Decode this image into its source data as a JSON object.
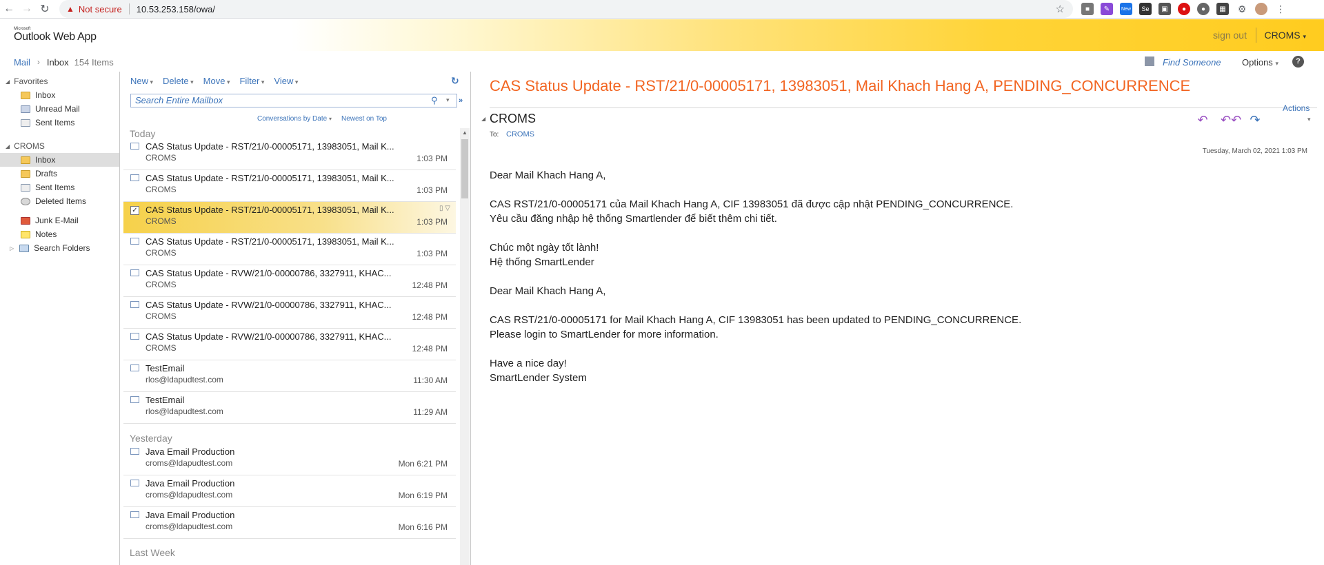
{
  "browser": {
    "security_label": "Not secure",
    "url": "10.53.253.158/owa/",
    "ext_new_badge": "New",
    "ext_se": "Se"
  },
  "header": {
    "logo_small": "Microsoft",
    "logo": "Outlook Web App",
    "signout": "sign out",
    "user": "CROMS"
  },
  "crumb": {
    "root": "Mail",
    "folder": "Inbox",
    "count": "154 Items",
    "find_someone": "Find Someone",
    "options": "Options"
  },
  "leftnav": {
    "favorites_label": "Favorites",
    "favorites": [
      "Inbox",
      "Unread Mail",
      "Sent Items"
    ],
    "mailbox_label": "CROMS",
    "folders": [
      "Inbox",
      "Drafts",
      "Sent Items",
      "Deleted Items",
      "Junk E-Mail",
      "Notes",
      "Search Folders"
    ]
  },
  "list": {
    "toolbar": [
      "New",
      "Delete",
      "Move",
      "Filter",
      "View"
    ],
    "search_placeholder": "Search Entire Mailbox",
    "sort_by": "Conversations by Date",
    "sort_order": "Newest on Top",
    "groups": [
      "Today",
      "Yesterday",
      "Last Week"
    ],
    "messages": [
      {
        "subject": "CAS Status Update - RST/21/0-00005171, 13983051, Mail K...",
        "from": "CROMS",
        "time": "1:03 PM"
      },
      {
        "subject": "CAS Status Update - RST/21/0-00005171, 13983051, Mail K...",
        "from": "CROMS",
        "time": "1:03 PM"
      },
      {
        "subject": "CAS Status Update - RST/21/0-00005171, 13983051, Mail K...",
        "from": "CROMS",
        "time": "1:03 PM"
      },
      {
        "subject": "CAS Status Update - RST/21/0-00005171, 13983051, Mail K...",
        "from": "CROMS",
        "time": "1:03 PM"
      },
      {
        "subject": "CAS Status Update - RVW/21/0-00000786, 3327911, KHAC...",
        "from": "CROMS",
        "time": "12:48 PM"
      },
      {
        "subject": "CAS Status Update - RVW/21/0-00000786, 3327911, KHAC...",
        "from": "CROMS",
        "time": "12:48 PM"
      },
      {
        "subject": "CAS Status Update - RVW/21/0-00000786, 3327911, KHAC...",
        "from": "CROMS",
        "time": "12:48 PM"
      },
      {
        "subject": "TestEmail",
        "from": "rlos@ldapudtest.com",
        "time": "11:30 AM"
      },
      {
        "subject": "TestEmail",
        "from": "rlos@ldapudtest.com",
        "time": "11:29 AM"
      },
      {
        "subject": "Java Email Production",
        "from": "croms@ldapudtest.com",
        "time": "Mon 6:21 PM"
      },
      {
        "subject": "Java Email Production",
        "from": "croms@ldapudtest.com",
        "time": "Mon 6:19 PM"
      },
      {
        "subject": "Java Email Production",
        "from": "croms@ldapudtest.com",
        "time": "Mon 6:16 PM"
      }
    ]
  },
  "reading": {
    "subject": "CAS Status Update - RST/21/0-00005171, 13983051, Mail Khach Hang A, PENDING_CONCURRENCE",
    "actions": "Actions",
    "sender": "CROMS",
    "to_label": "To:",
    "to_value": "CROMS",
    "date": "Tuesday, March 02, 2021 1:03 PM",
    "body": [
      "Dear Mail Khach Hang A,",
      "",
      "CAS RST/21/0-00005171 của Mail Khach Hang A, CIF 13983051 đã được cập nhật PENDING_CONCURRENCE.",
      "Yêu cầu đăng nhập hệ thống Smartlender để biết thêm chi tiết.",
      "",
      "Chúc một ngày tốt lành!",
      "Hệ thống SmartLender",
      "",
      "Dear Mail Khach Hang A,",
      "",
      "CAS RST/21/0-00005171 for Mail Khach Hang A, CIF 13983051 has been updated to PENDING_CONCURRENCE.",
      "Please login to SmartLender for more information.",
      "",
      "Have a nice day!",
      "SmartLender System"
    ]
  },
  "colors": {
    "accent": "#3b73b9",
    "subject": "#f26522",
    "selected_row": "#f6d14a"
  }
}
